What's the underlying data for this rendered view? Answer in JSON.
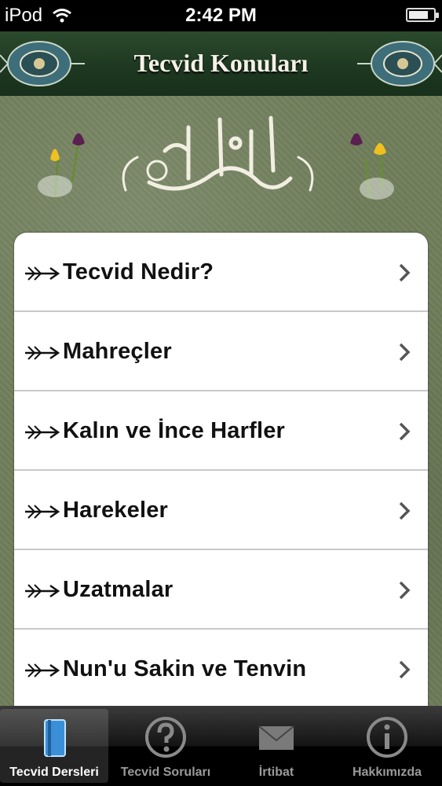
{
  "status": {
    "carrier": "iPod",
    "time": "2:42 PM"
  },
  "header": {
    "title": "Tecvid Konuları"
  },
  "list": {
    "items": [
      {
        "label": "Tecvid Nedir?"
      },
      {
        "label": "Mahreçler"
      },
      {
        "label": "Kalın ve İnce Harfler"
      },
      {
        "label": "Harekeler"
      },
      {
        "label": "Uzatmalar"
      },
      {
        "label": "Nun'u Sakin ve Tenvin"
      }
    ]
  },
  "tabs": [
    {
      "label": "Tecvid Dersleri",
      "icon": "book-icon",
      "active": true
    },
    {
      "label": "Tecvid Soruları",
      "icon": "question-icon",
      "active": false
    },
    {
      "label": "İrtibat",
      "icon": "envelope-icon",
      "active": false
    },
    {
      "label": "Hakkımızda",
      "icon": "info-icon",
      "active": false
    }
  ],
  "colors": {
    "header": "#1d3720",
    "background": "#6f7e5b",
    "tabbar": "#000000"
  }
}
